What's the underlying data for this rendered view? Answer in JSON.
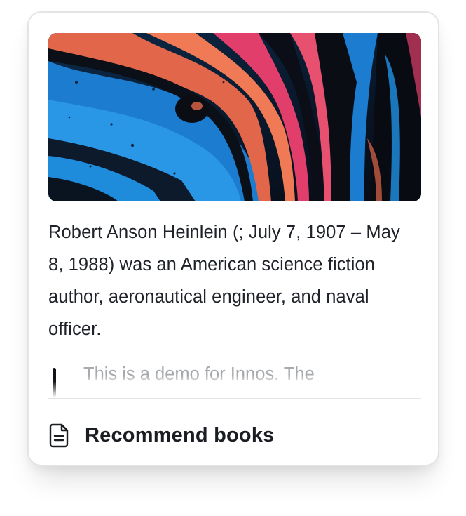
{
  "card": {
    "cover": {
      "alt": "Abstract fluid art of swirling blue, orange and pink paint on black",
      "colors": {
        "blue": "#1f86d6",
        "orange": "#e2674a",
        "pink": "#e23e6b",
        "black": "#0a0d14"
      }
    },
    "description": "Robert Anson Heinlein (; July 7, 1907 – May 8, 1988) was an American science fiction author, aeronautical engineer, and naval officer.",
    "note": "This is a demo for Innos. The",
    "action": {
      "icon": "document-icon",
      "label": "Recommend books"
    }
  },
  "colors": {
    "card_border": "#e4e4e7",
    "text": "#1f2329",
    "muted_text": "#a6a9ad"
  }
}
